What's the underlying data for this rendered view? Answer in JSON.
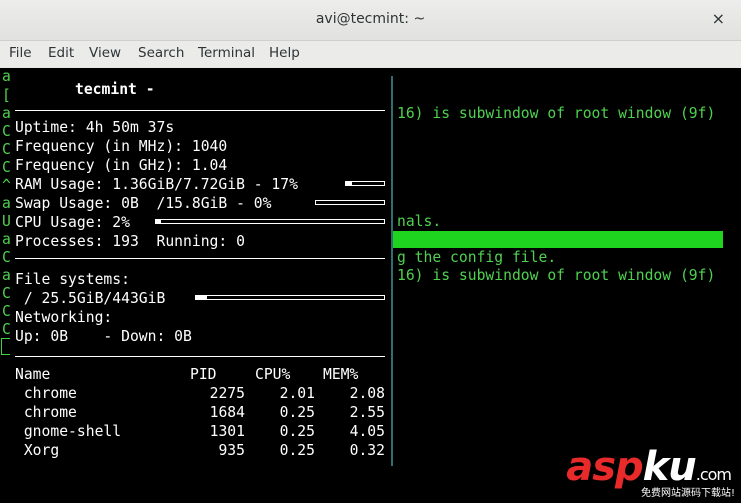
{
  "window": {
    "title": "avi@tecmint: ~",
    "close_glyph": "×"
  },
  "menu": [
    "File",
    "Edit",
    "View",
    "Search",
    "Terminal",
    "Help"
  ],
  "terminal": {
    "right_lines": [
      "16) is subwindow of root window (9f)",
      "nals.",
      "g the config file.",
      "16) is subwindow of root window (9f)"
    ],
    "left_chars": [
      "a",
      "[",
      "a",
      "C",
      "C",
      "C",
      "^",
      "a",
      "U",
      "a",
      "C",
      "a",
      "C",
      "C",
      "C"
    ]
  },
  "conky": {
    "title": "tecmint -",
    "uptime": "Uptime: 4h 50m 37s",
    "freq_mhz": "Frequency (in MHz): 1040",
    "freq_ghz": "Frequency (in GHz): 1.04",
    "ram": "RAM Usage: 1.36GiB/7.72GiB - 17%",
    "ram_pct": 17,
    "swap": "Swap Usage: 0B  /15.8GiB - 0%",
    "swap_pct": 0,
    "cpu": "CPU Usage: 2%",
    "cpu_pct": 2,
    "processes": "Processes: 193  Running: 0",
    "fs_label": "File systems:",
    "fs_root": " / 25.5GiB/443GiB",
    "fs_pct": 6,
    "net_label": "Networking:",
    "net": "Up: 0B    - Down: 0B",
    "proc_headers": [
      "Name",
      "PID",
      "CPU%",
      "MEM%"
    ],
    "procs": [
      {
        "name": " chrome",
        "pid": "2275",
        "cpu": "2.01",
        "mem": "2.08"
      },
      {
        "name": " chrome",
        "pid": "1684",
        "cpu": "0.25",
        "mem": "2.55"
      },
      {
        "name": " gnome-shell",
        "pid": "1301",
        "cpu": "0.25",
        "mem": "4.05"
      },
      {
        "name": " Xorg",
        "pid": "935",
        "cpu": "0.25",
        "mem": "0.32"
      }
    ]
  },
  "watermark": {
    "asp": "asp",
    "ku": "ku",
    "com": ".com",
    "sub": "免费网站源码下载站!"
  }
}
